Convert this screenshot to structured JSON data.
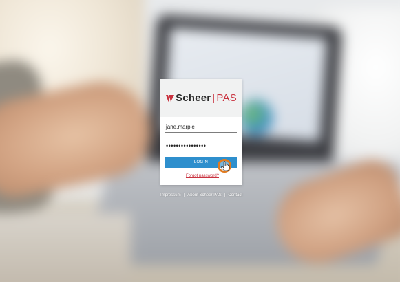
{
  "brand": {
    "name": "Scheer",
    "separator": "|",
    "product": "PAS",
    "accent_color": "#c9323f"
  },
  "login": {
    "username_value": "jane.marple",
    "password_masked": "••••••••••••••••",
    "submit_label": "LOGIN",
    "button_color": "#2e8fcd",
    "forgot_password_label": "Forgot password?"
  },
  "footer": {
    "links": [
      "Impressum",
      "About Scheer PAS",
      "Contact"
    ],
    "separator": "|"
  },
  "icons": {
    "logo_mark": "scheer-logo-mark",
    "cursor": "hand-pointer-icon"
  }
}
